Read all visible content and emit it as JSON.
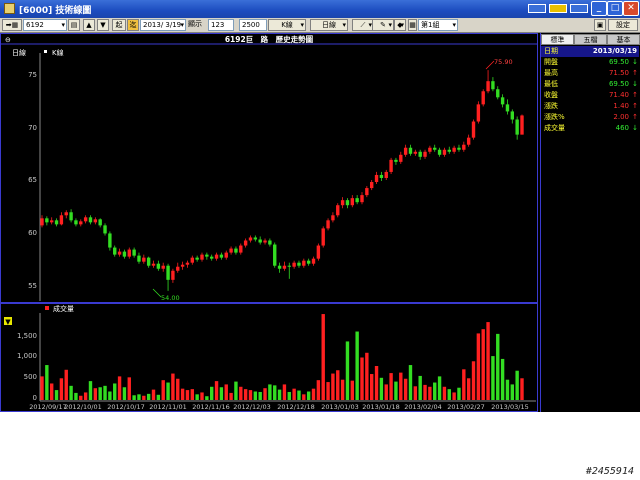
{
  "window": {
    "title": "[6000] 技術線圖"
  },
  "toolbar": {
    "code_value": "6192",
    "fetch_label": "起",
    "fetch2_label": "迄",
    "date_value": "2013/ 3/19",
    "show_label": "顯示",
    "show_value": "123",
    "count_value": "2500",
    "k_label": "K線",
    "period_label": "日線",
    "group_label": "第1組",
    "settings_label": "設定"
  },
  "chart": {
    "title": "6192巨　路　歷史走勢圖",
    "period_tag": "日線",
    "kline_legend": "K線",
    "volume_legend": "成交量",
    "high_marker": "75.90",
    "low_marker": "54.00",
    "price_ticks": [
      "75",
      "70",
      "65",
      "60",
      "55"
    ],
    "volume_ticks": [
      "1,500",
      "1,000",
      "500",
      "0"
    ],
    "date_ticks": [
      "2012/09/17",
      "2012/10/01",
      "2012/10/17",
      "2012/11/01",
      "2012/11/16",
      "2012/12/03",
      "2012/12/18",
      "2013/01/03",
      "2013/01/18",
      "2013/02/04",
      "2013/02/27",
      "2013/03/15"
    ],
    "colors": {
      "up": "#ff2020",
      "down": "#33dd22",
      "frame": "#3a3ad0",
      "axis_text": "#c8c8c8"
    }
  },
  "side": {
    "tabs": [
      "標準",
      "五檔",
      "基本"
    ],
    "rows": [
      {
        "label": "日期",
        "value": "2013/03/19",
        "arrow": ""
      },
      {
        "label": "開盤",
        "value": "69.50",
        "arrow": "↓"
      },
      {
        "label": "最高",
        "value": "71.50",
        "arrow": "↑"
      },
      {
        "label": "最低",
        "value": "69.50",
        "arrow": "↓"
      },
      {
        "label": "收盤",
        "value": "71.40",
        "arrow": "↑"
      },
      {
        "label": "漲跌",
        "value": "1.40",
        "arrow": "↑"
      },
      {
        "label": "漲跌%",
        "value": "2.00",
        "arrow": "↑"
      },
      {
        "label": "成交量",
        "value": "460",
        "arrow": "↓"
      }
    ]
  },
  "watermark": "#2455914",
  "chart_data": {
    "type": "candlestick",
    "title": "6192巨　路　歷史走勢圖",
    "ylim": [
      53,
      77
    ],
    "volume_ylim": [
      0,
      1800
    ],
    "candles": [
      {
        "o": 60.5,
        "c": 61.2,
        "h": 61.5,
        "l": 60.3,
        "v": 500
      },
      {
        "o": 61.2,
        "c": 60.8,
        "h": 61.4,
        "l": 60.5,
        "v": 740
      },
      {
        "o": 60.8,
        "c": 61.0,
        "h": 61.3,
        "l": 60.6,
        "v": 350
      },
      {
        "o": 61.0,
        "c": 60.6,
        "h": 61.2,
        "l": 60.4,
        "v": 210
      },
      {
        "o": 60.6,
        "c": 61.5,
        "h": 61.8,
        "l": 60.5,
        "v": 460
      },
      {
        "o": 61.5,
        "c": 61.8,
        "h": 62.0,
        "l": 61.2,
        "v": 640
      },
      {
        "o": 61.8,
        "c": 61.0,
        "h": 62.1,
        "l": 60.8,
        "v": 300
      },
      {
        "o": 61.0,
        "c": 60.6,
        "h": 61.2,
        "l": 60.4,
        "v": 150
      },
      {
        "o": 60.6,
        "c": 60.9,
        "h": 61.1,
        "l": 60.4,
        "v": 90
      },
      {
        "o": 60.9,
        "c": 61.3,
        "h": 61.5,
        "l": 60.7,
        "v": 160
      },
      {
        "o": 61.3,
        "c": 60.8,
        "h": 61.5,
        "l": 60.6,
        "v": 400
      },
      {
        "o": 60.8,
        "c": 61.1,
        "h": 61.3,
        "l": 60.6,
        "v": 250
      },
      {
        "o": 61.1,
        "c": 60.5,
        "h": 61.2,
        "l": 60.3,
        "v": 270
      },
      {
        "o": 60.5,
        "c": 59.7,
        "h": 60.7,
        "l": 59.5,
        "v": 300
      },
      {
        "o": 59.7,
        "c": 58.3,
        "h": 59.9,
        "l": 58.0,
        "v": 180
      },
      {
        "o": 58.3,
        "c": 57.6,
        "h": 58.5,
        "l": 57.4,
        "v": 350
      },
      {
        "o": 57.6,
        "c": 57.9,
        "h": 58.2,
        "l": 57.4,
        "v": 500
      },
      {
        "o": 57.9,
        "c": 57.4,
        "h": 58.1,
        "l": 57.2,
        "v": 270
      },
      {
        "o": 57.4,
        "c": 58.1,
        "h": 58.3,
        "l": 57.2,
        "v": 480
      },
      {
        "o": 58.1,
        "c": 57.5,
        "h": 58.3,
        "l": 57.3,
        "v": 100
      },
      {
        "o": 57.5,
        "c": 56.9,
        "h": 57.8,
        "l": 56.7,
        "v": 120
      },
      {
        "o": 56.9,
        "c": 57.3,
        "h": 57.6,
        "l": 56.7,
        "v": 90
      },
      {
        "o": 57.3,
        "c": 56.5,
        "h": 57.4,
        "l": 56.3,
        "v": 130
      },
      {
        "o": 56.5,
        "c": 56.7,
        "h": 57.0,
        "l": 56.3,
        "v": 220
      },
      {
        "o": 56.7,
        "c": 56.2,
        "h": 57.0,
        "l": 56.0,
        "v": 110
      },
      {
        "o": 56.2,
        "c": 56.5,
        "h": 56.8,
        "l": 55.9,
        "v": 420
      },
      {
        "o": 56.5,
        "c": 55.1,
        "h": 56.7,
        "l": 54.0,
        "v": 370
      },
      {
        "o": 55.1,
        "c": 56.0,
        "h": 56.2,
        "l": 54.8,
        "v": 560
      },
      {
        "o": 56.0,
        "c": 56.4,
        "h": 56.8,
        "l": 55.8,
        "v": 450
      },
      {
        "o": 56.4,
        "c": 56.6,
        "h": 56.9,
        "l": 56.1,
        "v": 240
      },
      {
        "o": 56.6,
        "c": 56.8,
        "h": 57.0,
        "l": 56.3,
        "v": 210
      },
      {
        "o": 56.8,
        "c": 57.3,
        "h": 57.5,
        "l": 56.6,
        "v": 230
      },
      {
        "o": 57.3,
        "c": 57.1,
        "h": 57.5,
        "l": 56.9,
        "v": 120
      },
      {
        "o": 57.1,
        "c": 57.6,
        "h": 57.8,
        "l": 56.9,
        "v": 160
      },
      {
        "o": 57.6,
        "c": 57.4,
        "h": 57.8,
        "l": 57.1,
        "v": 80
      },
      {
        "o": 57.4,
        "c": 57.2,
        "h": 57.6,
        "l": 57.0,
        "v": 280
      },
      {
        "o": 57.2,
        "c": 57.6,
        "h": 57.8,
        "l": 57.0,
        "v": 400
      },
      {
        "o": 57.6,
        "c": 57.3,
        "h": 57.8,
        "l": 57.1,
        "v": 270
      },
      {
        "o": 57.3,
        "c": 57.8,
        "h": 58.0,
        "l": 57.1,
        "v": 330
      },
      {
        "o": 57.8,
        "c": 58.2,
        "h": 58.4,
        "l": 57.6,
        "v": 150
      },
      {
        "o": 58.2,
        "c": 57.8,
        "h": 58.4,
        "l": 57.6,
        "v": 390
      },
      {
        "o": 57.8,
        "c": 58.5,
        "h": 58.7,
        "l": 57.6,
        "v": 280
      },
      {
        "o": 58.5,
        "c": 59.0,
        "h": 59.2,
        "l": 58.3,
        "v": 230
      },
      {
        "o": 59.0,
        "c": 59.3,
        "h": 59.5,
        "l": 58.8,
        "v": 210
      },
      {
        "o": 59.3,
        "c": 59.1,
        "h": 59.5,
        "l": 58.9,
        "v": 180
      },
      {
        "o": 59.1,
        "c": 58.8,
        "h": 59.4,
        "l": 58.6,
        "v": 170
      },
      {
        "o": 58.8,
        "c": 59.0,
        "h": 59.2,
        "l": 58.6,
        "v": 250
      },
      {
        "o": 59.0,
        "c": 58.6,
        "h": 59.2,
        "l": 58.4,
        "v": 330
      },
      {
        "o": 58.6,
        "c": 56.5,
        "h": 58.8,
        "l": 56.3,
        "v": 310
      },
      {
        "o": 56.5,
        "c": 56.2,
        "h": 56.8,
        "l": 55.8,
        "v": 220
      },
      {
        "o": 56.2,
        "c": 56.5,
        "h": 56.9,
        "l": 56.0,
        "v": 330
      },
      {
        "o": 56.5,
        "c": 56.4,
        "h": 56.8,
        "l": 55.2,
        "v": 170
      },
      {
        "o": 56.4,
        "c": 56.8,
        "h": 57.0,
        "l": 56.2,
        "v": 240
      },
      {
        "o": 56.8,
        "c": 56.5,
        "h": 57.0,
        "l": 56.3,
        "v": 200
      },
      {
        "o": 56.5,
        "c": 57.0,
        "h": 57.2,
        "l": 56.3,
        "v": 120
      },
      {
        "o": 57.0,
        "c": 56.7,
        "h": 57.2,
        "l": 56.5,
        "v": 180
      },
      {
        "o": 56.7,
        "c": 57.2,
        "h": 57.4,
        "l": 56.5,
        "v": 240
      },
      {
        "o": 57.2,
        "c": 58.5,
        "h": 58.7,
        "l": 57.0,
        "v": 420
      },
      {
        "o": 58.5,
        "c": 60.2,
        "h": 60.4,
        "l": 58.3,
        "v": 1820
      },
      {
        "o": 60.2,
        "c": 61.0,
        "h": 61.2,
        "l": 60.0,
        "v": 380
      },
      {
        "o": 61.0,
        "c": 61.5,
        "h": 61.8,
        "l": 60.8,
        "v": 560
      },
      {
        "o": 61.5,
        "c": 62.5,
        "h": 62.7,
        "l": 61.3,
        "v": 630
      },
      {
        "o": 62.5,
        "c": 63.0,
        "h": 63.3,
        "l": 62.2,
        "v": 430
      },
      {
        "o": 63.0,
        "c": 62.5,
        "h": 63.2,
        "l": 62.2,
        "v": 1240
      },
      {
        "o": 62.5,
        "c": 63.2,
        "h": 63.5,
        "l": 62.3,
        "v": 410
      },
      {
        "o": 63.2,
        "c": 62.8,
        "h": 63.5,
        "l": 62.6,
        "v": 1450
      },
      {
        "o": 62.8,
        "c": 63.5,
        "h": 63.8,
        "l": 62.6,
        "v": 900
      },
      {
        "o": 63.5,
        "c": 64.2,
        "h": 64.4,
        "l": 63.3,
        "v": 1000
      },
      {
        "o": 64.2,
        "c": 64.8,
        "h": 65.0,
        "l": 64.0,
        "v": 550
      },
      {
        "o": 64.8,
        "c": 65.5,
        "h": 65.8,
        "l": 64.6,
        "v": 720
      },
      {
        "o": 65.5,
        "c": 65.2,
        "h": 65.8,
        "l": 64.9,
        "v": 470
      },
      {
        "o": 65.2,
        "c": 65.8,
        "h": 66.0,
        "l": 65.0,
        "v": 330
      },
      {
        "o": 65.8,
        "c": 67.0,
        "h": 67.2,
        "l": 65.6,
        "v": 570
      },
      {
        "o": 67.0,
        "c": 66.8,
        "h": 67.2,
        "l": 66.5,
        "v": 390
      },
      {
        "o": 66.8,
        "c": 67.5,
        "h": 67.8,
        "l": 66.6,
        "v": 580
      },
      {
        "o": 67.5,
        "c": 68.2,
        "h": 68.5,
        "l": 67.3,
        "v": 450
      },
      {
        "o": 68.2,
        "c": 67.6,
        "h": 68.5,
        "l": 67.4,
        "v": 740
      },
      {
        "o": 67.6,
        "c": 67.8,
        "h": 68.0,
        "l": 67.4,
        "v": 290
      },
      {
        "o": 67.8,
        "c": 67.3,
        "h": 68.0,
        "l": 67.0,
        "v": 510
      },
      {
        "o": 67.3,
        "c": 67.8,
        "h": 68.0,
        "l": 67.1,
        "v": 320
      },
      {
        "o": 67.8,
        "c": 68.2,
        "h": 68.4,
        "l": 67.6,
        "v": 280
      },
      {
        "o": 68.2,
        "c": 68.0,
        "h": 68.5,
        "l": 67.8,
        "v": 370
      },
      {
        "o": 68.0,
        "c": 67.5,
        "h": 68.2,
        "l": 67.3,
        "v": 500
      },
      {
        "o": 67.5,
        "c": 68.0,
        "h": 68.2,
        "l": 67.3,
        "v": 280
      },
      {
        "o": 68.0,
        "c": 67.8,
        "h": 68.3,
        "l": 67.6,
        "v": 230
      },
      {
        "o": 67.8,
        "c": 68.2,
        "h": 68.4,
        "l": 67.6,
        "v": 160
      },
      {
        "o": 68.2,
        "c": 68.0,
        "h": 68.5,
        "l": 67.8,
        "v": 260
      },
      {
        "o": 68.0,
        "c": 68.5,
        "h": 68.8,
        "l": 67.8,
        "v": 650
      },
      {
        "o": 68.5,
        "c": 69.2,
        "h": 69.5,
        "l": 68.3,
        "v": 460
      },
      {
        "o": 69.2,
        "c": 70.8,
        "h": 71.0,
        "l": 69.0,
        "v": 820
      },
      {
        "o": 70.8,
        "c": 72.5,
        "h": 72.8,
        "l": 70.6,
        "v": 1410
      },
      {
        "o": 72.5,
        "c": 73.8,
        "h": 74.0,
        "l": 72.3,
        "v": 1500
      },
      {
        "o": 73.8,
        "c": 74.8,
        "h": 75.9,
        "l": 73.6,
        "v": 1650
      },
      {
        "o": 74.8,
        "c": 74.0,
        "h": 75.2,
        "l": 73.8,
        "v": 930
      },
      {
        "o": 74.0,
        "c": 73.2,
        "h": 74.3,
        "l": 73.0,
        "v": 1400
      },
      {
        "o": 73.2,
        "c": 72.5,
        "h": 73.5,
        "l": 72.2,
        "v": 870
      },
      {
        "o": 72.5,
        "c": 71.8,
        "h": 73.0,
        "l": 71.5,
        "v": 430
      },
      {
        "o": 71.8,
        "c": 71.0,
        "h": 72.0,
        "l": 70.6,
        "v": 330
      },
      {
        "o": 71.0,
        "c": 69.5,
        "h": 71.3,
        "l": 69.0,
        "v": 620
      },
      {
        "o": 69.5,
        "c": 71.4,
        "h": 71.5,
        "l": 69.5,
        "v": 460
      }
    ]
  }
}
